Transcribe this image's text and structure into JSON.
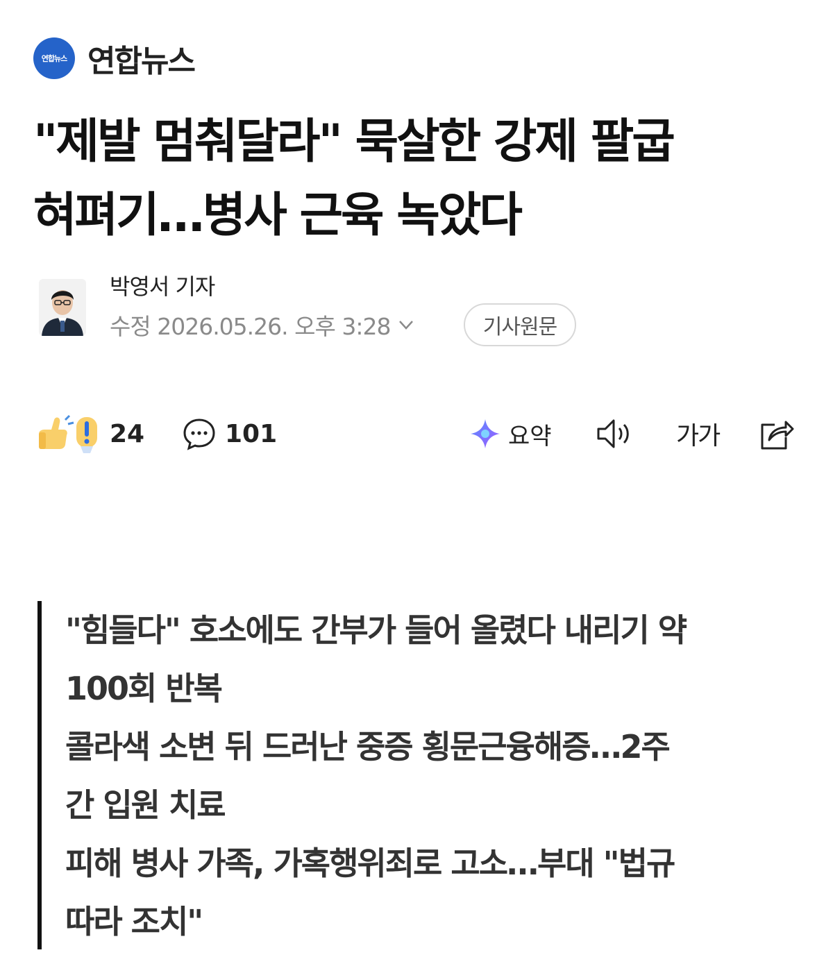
{
  "press": {
    "logo_text": "연합뉴스",
    "name": "연합뉴스"
  },
  "article": {
    "headline_line1": "\"제발 멈춰달라\" 묵살한 강제 팔굽",
    "headline_line2": "혀펴기…병사 근육 녹았다"
  },
  "byline": {
    "reporter": "박영서 기자",
    "dateline": "수정 2026.05.26. 오후 3:28",
    "original_button": "기사원문"
  },
  "actions": {
    "reactions_count": "24",
    "comments_count": "101",
    "summary_label": "요약",
    "font_size_label": "가가"
  },
  "summary": {
    "lines": [
      "\"힘들다\" 호소에도 간부가 들어 올렸다 내리기 약",
      "100회 반복",
      "콜라색 소변 뒤 드러난 중증 횡문근융해증…2주",
      "간 입원 치료",
      "피해 병사 가족, 가혹행위죄로 고소…부대 \"법규",
      "따라 조치\""
    ]
  },
  "icons": {
    "reaction": "thumb-and-exclamation-icon",
    "comment": "speech-bubble-icon",
    "summary": "ai-sparkle-icon",
    "listen": "speaker-icon",
    "share": "share-icon"
  },
  "colors": {
    "logo_blue": "#2563c9",
    "text": "#111111",
    "muted": "#8a8a8a"
  }
}
